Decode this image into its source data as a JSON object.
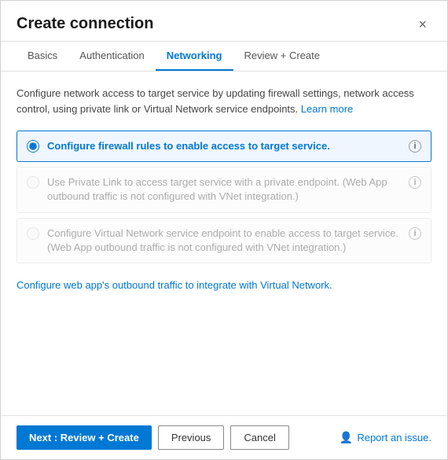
{
  "dialog": {
    "title": "Create connection",
    "close_label": "×"
  },
  "tabs": [
    {
      "id": "basics",
      "label": "Basics",
      "active": false
    },
    {
      "id": "authentication",
      "label": "Authentication",
      "active": false
    },
    {
      "id": "networking",
      "label": "Networking",
      "active": true
    },
    {
      "id": "review-create",
      "label": "Review + Create",
      "active": false
    }
  ],
  "body": {
    "description": "Configure network access to target service by updating firewall settings, network access control, using private link or Virtual Network service endpoints.",
    "learn_more_label": "Learn more",
    "radio_options": [
      {
        "id": "firewall",
        "label": "Configure firewall rules to enable access to target service.",
        "selected": true,
        "disabled": false,
        "has_info": true
      },
      {
        "id": "private-link",
        "label": "Use Private Link to access target service with a private endpoint. (Web App outbound traffic is not configured with VNet integration.)",
        "selected": false,
        "disabled": true,
        "has_info": true
      },
      {
        "id": "vnet-endpoint",
        "label": "Configure Virtual Network service endpoint to enable access to target service. (Web App outbound traffic is not configured with VNet integration.)",
        "selected": false,
        "disabled": true,
        "has_info": true
      }
    ],
    "configure_link_text": "Configure web app's outbound traffic to integrate with Virtual Network.",
    "info_icon_label": "ⓘ"
  },
  "footer": {
    "next_button_label": "Next : Review + Create",
    "previous_button_label": "Previous",
    "cancel_button_label": "Cancel",
    "report_label": "Report an issue."
  }
}
